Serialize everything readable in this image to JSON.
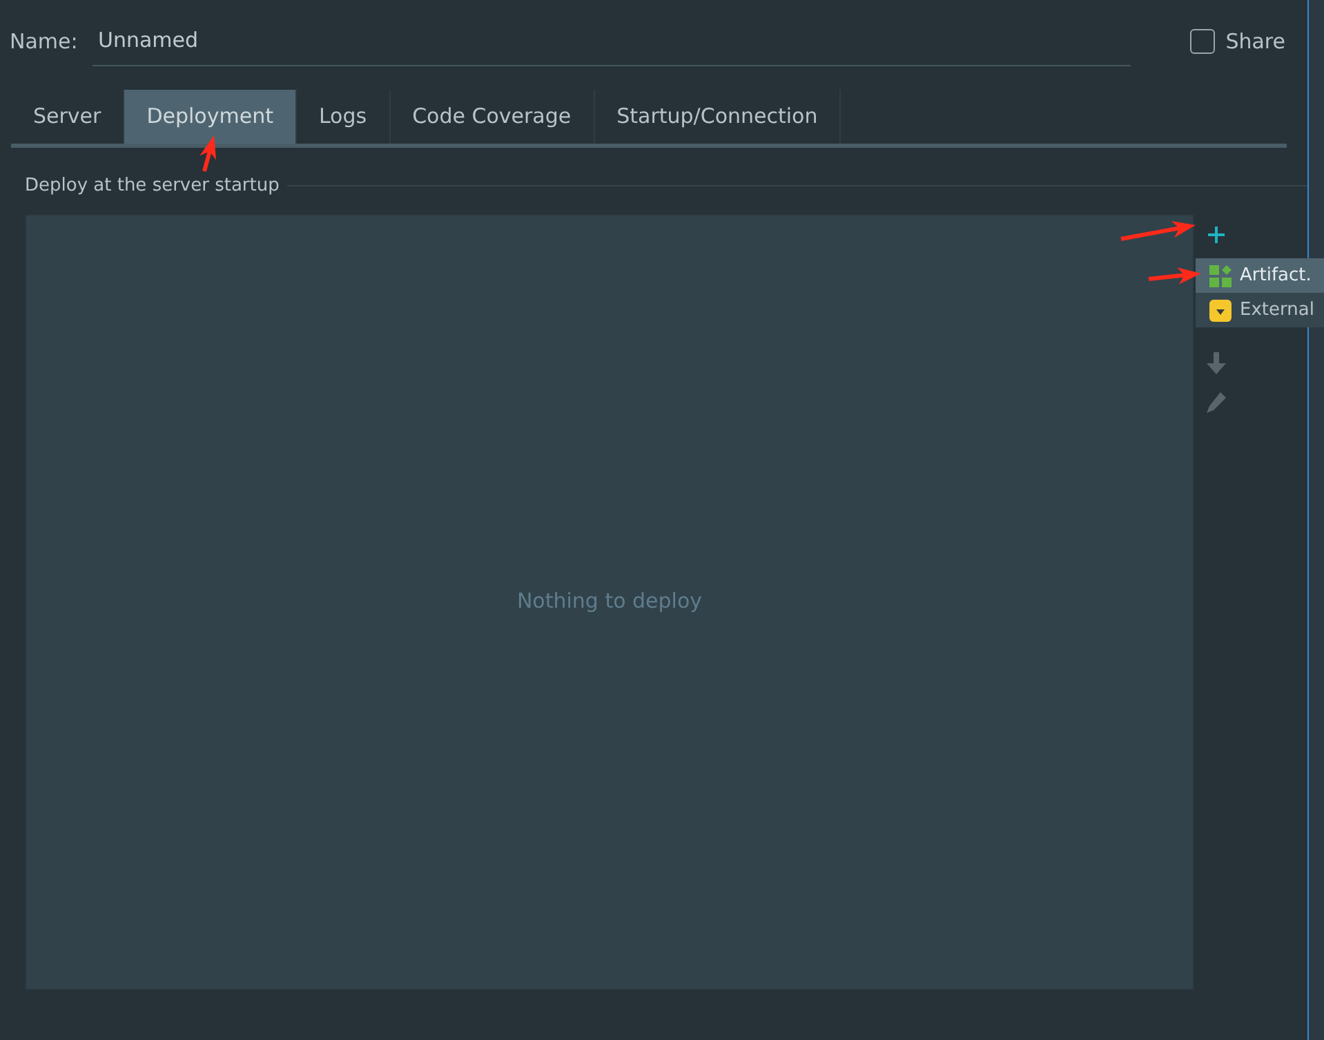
{
  "name_field": {
    "label": "Name:",
    "value": "Unnamed"
  },
  "share": {
    "label": "Share",
    "checked": false
  },
  "tabs": [
    {
      "label": "Server",
      "selected": false
    },
    {
      "label": "Deployment",
      "selected": true
    },
    {
      "label": "Logs",
      "selected": false
    },
    {
      "label": "Code Coverage",
      "selected": false
    },
    {
      "label": "Startup/Connection",
      "selected": false
    }
  ],
  "group_title": "Deploy at the server startup",
  "empty_text": "Nothing to deploy",
  "popup_menu": [
    {
      "label": "Artifact.",
      "kind": "artifact",
      "selected": true
    },
    {
      "label": "External",
      "kind": "external",
      "selected": false
    }
  ]
}
